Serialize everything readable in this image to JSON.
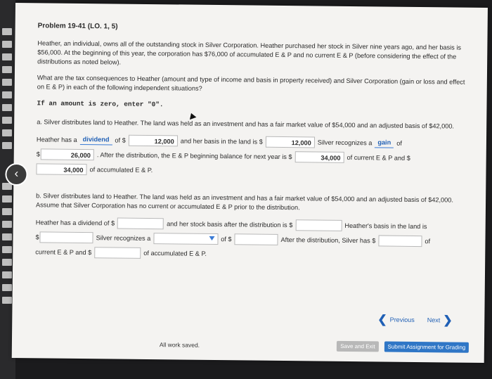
{
  "problem": {
    "title": "Problem 19-41 (LO. 1, 5)",
    "intro": "Heather, an individual, owns all of the outstanding stock in Silver Corporation. Heather purchased her stock in Silver nine years ago, and her basis is $56,000. At the beginning of this year, the corporation has $76,000 of accumulated E & P and no current E & P (before considering the effect of the distributions as noted below).",
    "question": "What are the tax consequences to Heather (amount and type of income and basis in property received) and Silver Corporation (gain or loss and effect on E & P) in each of the following independent situations?",
    "hint": "If an amount is zero, enter \"0\"."
  },
  "part_a": {
    "prompt": "a. Silver distributes land to Heather. The land was held as an investment and has a fair market value of $54,000 and an adjusted basis of $42,000.",
    "t1": "Heather has a",
    "dropdown1": "dividend",
    "t2": "of $",
    "v1": "12,000",
    "t3": "and her basis in the land is $",
    "v2": "12,000",
    "t4": "Silver recognizes a",
    "dropdown2": "gain",
    "t5": "of",
    "dollar": "$",
    "v3": "26,000",
    "t6": ". After the distribution, the E & P beginning balance for next year is $",
    "v4": "34,000",
    "t7": "of current E & P and $",
    "v5": "34,000",
    "t8": "of accumulated E & P."
  },
  "part_b": {
    "prompt": "b. Silver distributes land to Heather. The land was held as an investment and has a fair market value of $54,000 and an adjusted basis of $42,000. Assume that Silver Corporation has no current or accumulated E & P prior to the distribution.",
    "t1": "Heather has a dividend of $",
    "t2": "and her stock basis after the distribution is $",
    "t3": "Heather's basis in the land is",
    "dollar": "$",
    "t4": "Silver recognizes a",
    "t5": "of $",
    "t6": "After the distribution, Silver has $",
    "t7": "of",
    "t8": "current E & P and $",
    "t9": "of accumulated E & P."
  },
  "nav": {
    "previous": "Previous",
    "next": "Next"
  },
  "footer": {
    "saved": "All work saved.",
    "save_exit": "Save and Exit",
    "submit": "Submit Assignment for Grading"
  }
}
